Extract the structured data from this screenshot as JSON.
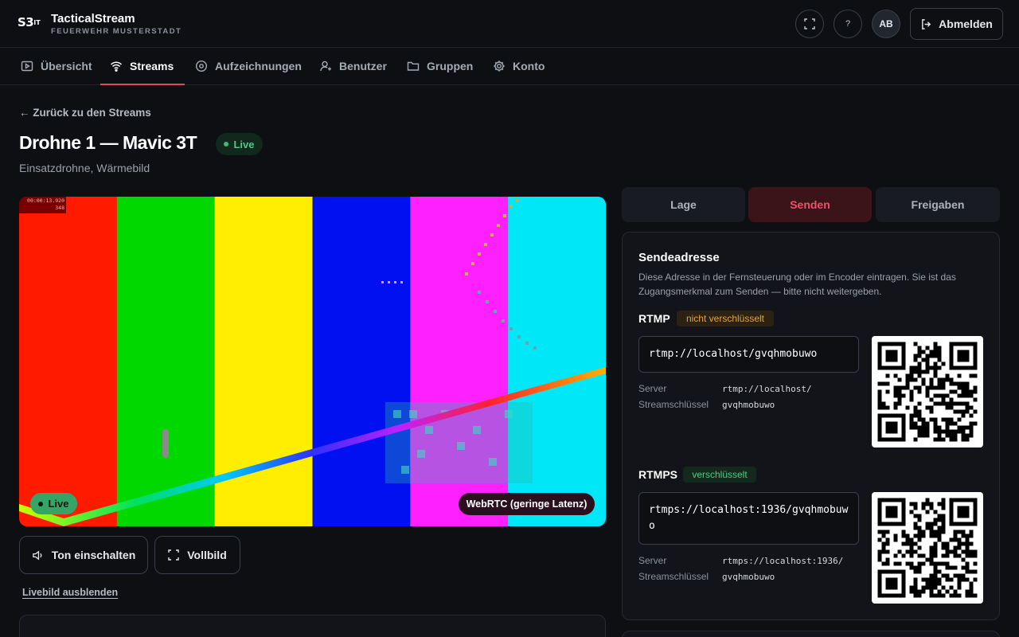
{
  "header": {
    "logo_main": "S3",
    "logo_sup": "IT",
    "app_title": "TacticalStream",
    "org": "FEUERWEHR MUSTERSTADT",
    "help_label": "?",
    "avatar_initials": "AB",
    "logout_label": "Abmelden"
  },
  "nav": {
    "items": [
      {
        "label": "Übersicht",
        "icon": "play-square-icon"
      },
      {
        "label": "Streams",
        "icon": "wifi-icon"
      },
      {
        "label": "Aufzeichnungen",
        "icon": "record-icon"
      },
      {
        "label": "Benutzer",
        "icon": "user-icon"
      },
      {
        "label": "Gruppen",
        "icon": "folder-icon"
      },
      {
        "label": "Konto",
        "icon": "gear-icon"
      }
    ],
    "active": "Streams"
  },
  "page": {
    "back_label": "← Zurück zu den Streams",
    "title": "Drohne 1 — Mavic 3T",
    "status": "Live",
    "subtitle": "Einsatzdrohne, Wärmebild"
  },
  "video": {
    "timestamp": "00:00:13.920",
    "frame": "348",
    "live_label": "Live",
    "transport_label": "WebRTC (geringe Latenz)",
    "sound_button": "Ton einschalten",
    "fullscreen_button": "Vollbild",
    "hide_link": "Livebild ausblenden",
    "bar_colors": [
      "#ff1a00",
      "#00d800",
      "#ffee00",
      "#0010f0",
      "#ff20ff",
      "#00e8f8"
    ]
  },
  "tabs": {
    "items": [
      "Lage",
      "Senden",
      "Freigaben"
    ],
    "active": "Senden"
  },
  "send": {
    "title": "Sendeadresse",
    "description": "Diese Adresse in der Fernsteuerung oder im Encoder eintragen. Sie ist das Zugangsmerkmal zum Senden — bitte nicht weitergeben.",
    "rtmp": {
      "label": "RTMP",
      "badge": "nicht verschlüsselt",
      "url": "rtmp://localhost/gvqhmobuwo",
      "server_label": "Server",
      "server": "rtmp://localhost/",
      "key_label": "Streamschlüssel",
      "key": "gvqhmobuwo"
    },
    "rtmps": {
      "label": "RTMPS",
      "badge": "verschlüsselt",
      "url": "rtmps://localhost:1936/gvqhmobuwo",
      "server_label": "Server",
      "server": "rtmps://localhost:1936/",
      "key_label": "Streamschlüssel",
      "key": "gvqhmobuwo"
    }
  }
}
